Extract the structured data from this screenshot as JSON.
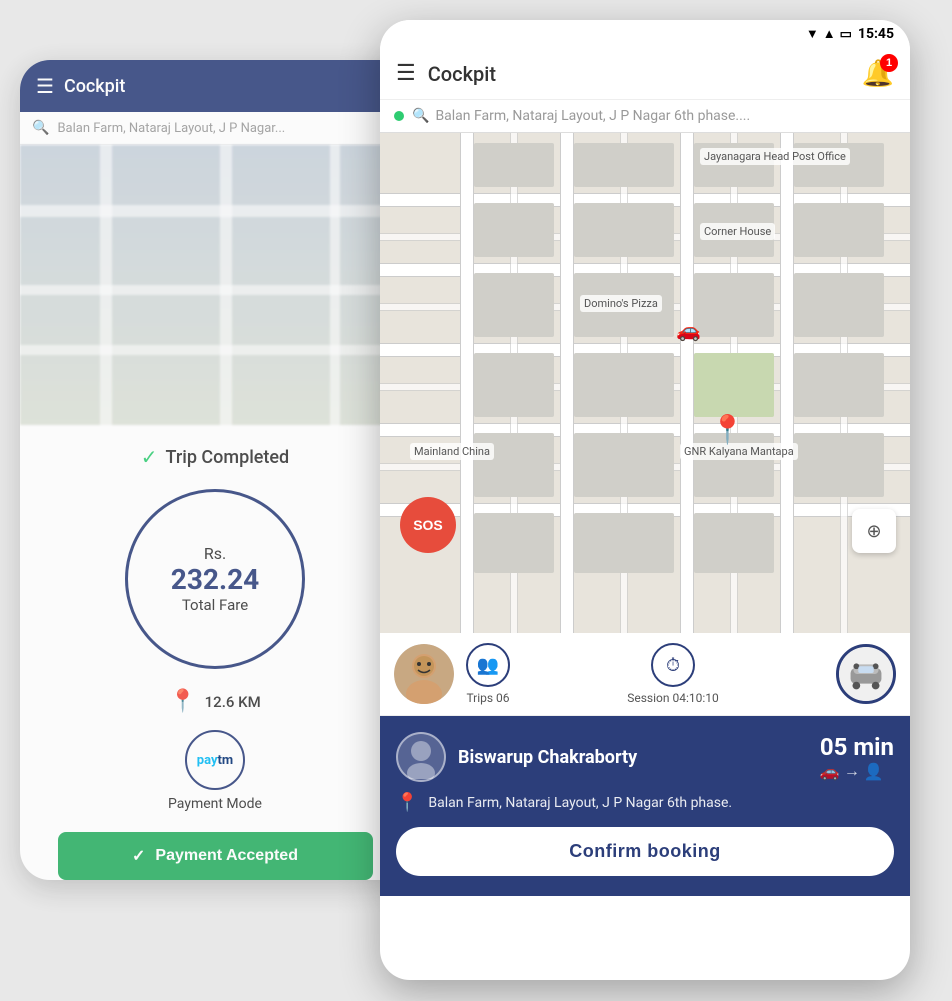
{
  "back_phone": {
    "header": {
      "menu_icon": "☰",
      "title": "Cockpit"
    },
    "search": {
      "placeholder": "Balan Farm, Nataraj Layout, J P Nagar..."
    },
    "trip": {
      "completed_label": "Trip Completed",
      "rs_label": "Rs.",
      "amount": "232.24",
      "total_fare_label": "Total Fare",
      "distance": "12.6 KM",
      "payment_mode_label": "Payment Mode",
      "paytm_label": "paytm",
      "payment_accepted": "Payment Accepted"
    }
  },
  "front_phone": {
    "status_bar": {
      "time": "15:45"
    },
    "header": {
      "menu_icon": "☰",
      "title": "Cockpit",
      "notification_count": "1"
    },
    "search": {
      "placeholder": "Balan Farm, Nataraj Layout, J P Nagar 6th phase...."
    },
    "map": {
      "sos_label": "SOS",
      "poi_1": "Jayanagara Head Post Office",
      "poi_2": "Corner House",
      "poi_3": "Domino's Pizza",
      "poi_4": "Mainland China",
      "poi_5": "GNR Kalyana Mantapa"
    },
    "driver_row": {
      "trips_label": "Trips 06",
      "session_label": "Session 04:10:10"
    },
    "booking": {
      "driver_name": "Biswarup Chakraborty",
      "eta_mins": "05 min",
      "location": "Balan Farm, Nataraj Layout, J P Nagar 6th phase.",
      "confirm_label": "Confirm booking"
    }
  }
}
